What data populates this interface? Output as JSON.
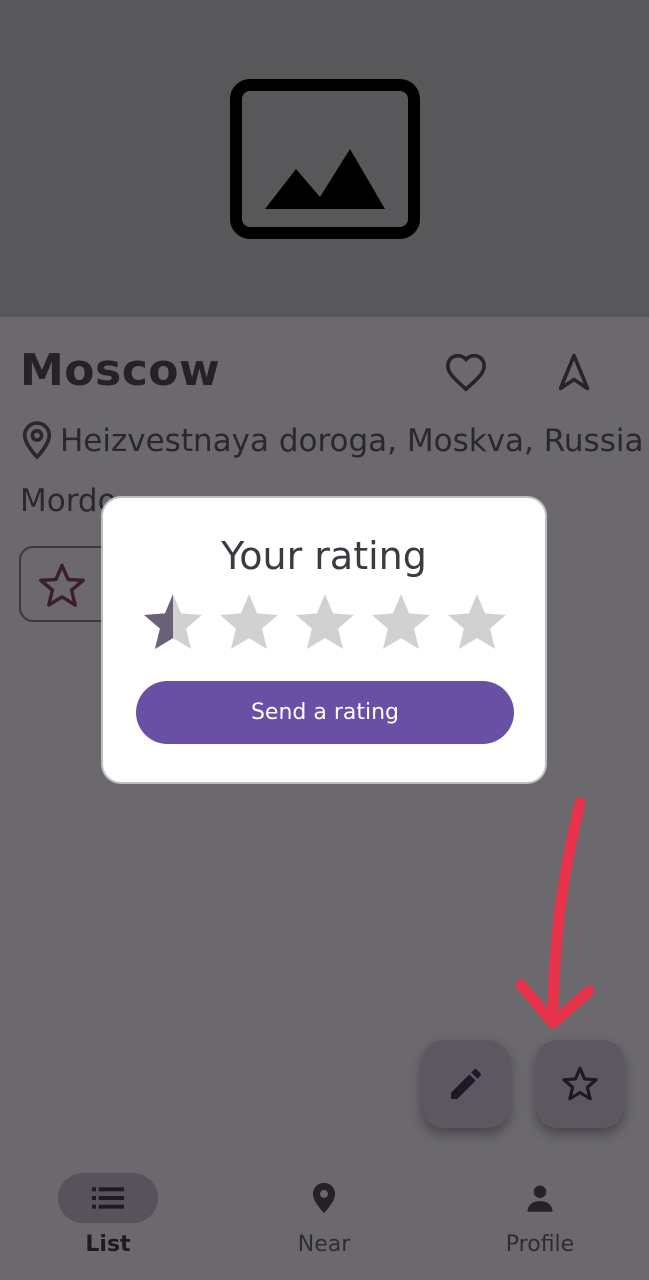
{
  "place": {
    "name": "Moscow",
    "address_line1": "Heizvestnaya doroga, Moskva, Russia",
    "address_line2": "Mordo"
  },
  "dialog": {
    "title": "Your rating",
    "rating_value": 0.5,
    "rating_max": 5,
    "send_label": "Send a rating"
  },
  "bottom_nav": {
    "items": [
      {
        "label": "List",
        "icon": "list-icon",
        "active": true
      },
      {
        "label": "Near",
        "icon": "location-pin-icon",
        "active": false
      },
      {
        "label": "Profile",
        "icon": "person-icon",
        "active": false
      }
    ]
  },
  "colors": {
    "scrim": "#6b696e",
    "primary": "#6950a4",
    "annotation_arrow": "#e8334a",
    "star_filled": "#6a6177",
    "star_empty": "#d1d1d3"
  },
  "icons": {
    "hero": "image-placeholder-icon",
    "favorite": "heart-outline-icon",
    "navigate": "navigation-arrow-icon",
    "address": "map-pin-outline-icon",
    "rate_chip": "star-outline-icon",
    "fab_edit": "pencil-icon",
    "fab_rate": "star-outline-icon"
  }
}
